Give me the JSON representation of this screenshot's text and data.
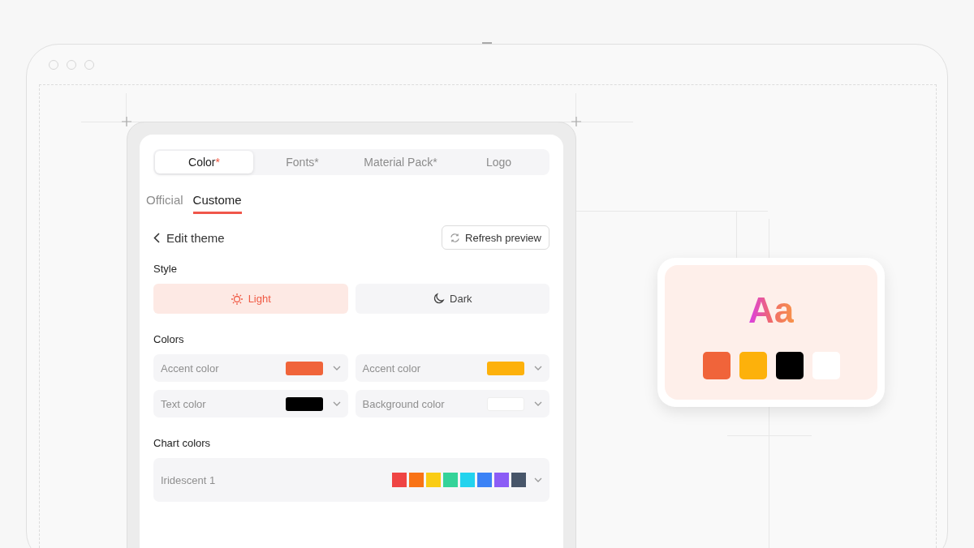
{
  "tabs": [
    {
      "label": "Color",
      "suffix": "*",
      "selected": true
    },
    {
      "label": "Fonts",
      "suffix": "*",
      "selected": false
    },
    {
      "label": "Material Pack",
      "suffix": "*",
      "selected": false
    },
    {
      "label": "Logo",
      "selected": false
    }
  ],
  "subtabs": [
    {
      "label": "Official",
      "selected": false
    },
    {
      "label": "Custome",
      "selected": true
    }
  ],
  "header": {
    "title": "Edit theme",
    "refresh_button": "Refresh preview"
  },
  "style": {
    "label": "Style",
    "options": [
      {
        "kind": "light",
        "label": "Light",
        "selected": true
      },
      {
        "kind": "dark",
        "label": "Dark",
        "selected": false
      }
    ]
  },
  "colors": {
    "label": "Colors",
    "fields": [
      {
        "label": "Accent color",
        "color": "#f0643a"
      },
      {
        "label": "Accent color",
        "color": "#fdb10b"
      },
      {
        "label": "Text color",
        "color": "#000000"
      },
      {
        "label": "Background color",
        "color": "#ffffff"
      }
    ]
  },
  "chart_colors": {
    "label": "Chart colors",
    "palette": {
      "name": "Iridescent 1",
      "colors": [
        {
          "color": "#ef4444"
        },
        {
          "color": "#f97316"
        },
        {
          "color": "#facc15"
        },
        {
          "color": "#34d399"
        },
        {
          "color": "#22d3ee"
        },
        {
          "color": "#3b82f6"
        },
        {
          "color": "#8b5cf6"
        },
        {
          "color": "#475569"
        }
      ]
    }
  },
  "preview": {
    "sample": "Aa",
    "swatches": [
      {
        "color": "#f0643a"
      },
      {
        "color": "#fdb10b"
      },
      {
        "color": "#000000"
      },
      {
        "color": "#ffffff"
      }
    ]
  }
}
